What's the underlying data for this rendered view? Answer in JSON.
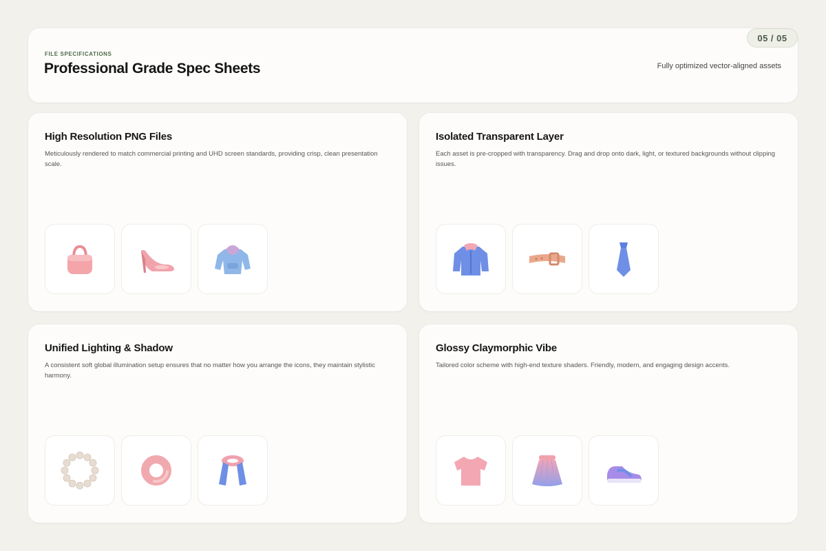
{
  "header": {
    "eyebrow": "FILE SPECIFICATIONS",
    "title": "Professional Grade Spec Sheets",
    "tagline": "Fully optimized vector-aligned assets",
    "page_indicator": "05 / 05"
  },
  "cards": [
    {
      "title": "High Resolution PNG Files",
      "description": "Meticulously rendered to match commercial printing and UHD screen standards, providing crisp, clean presentation scale.",
      "icons": [
        "handbag-icon",
        "high-heel-icon",
        "hoodie-icon"
      ]
    },
    {
      "title": "Isolated Transparent Layer",
      "description": "Each asset is pre-cropped with transparency. Drag and drop onto dark, light, or textured backgrounds without clipping issues.",
      "icons": [
        "jacket-icon",
        "belt-icon",
        "necktie-icon"
      ]
    },
    {
      "title": "Unified Lighting & Shadow",
      "description": "A consistent soft global illumination setup ensures that no matter how you arrange the icons, they maintain stylistic harmony.",
      "icons": [
        "pearl-bracelet-icon",
        "donut-ring-icon",
        "scarf-icon"
      ]
    },
    {
      "title": "Glossy Claymorphic Vibe",
      "description": "Tailored color scheme with high-end texture shaders. Friendly, modern, and engaging design accents.",
      "icons": [
        "t-shirt-icon",
        "skirt-icon",
        "sneaker-icon"
      ]
    }
  ],
  "colors": {
    "background": "#f3f1ec",
    "card": "#fdfcfa",
    "eyebrow": "#4e6a4b",
    "pink": "#f0a1a6",
    "blue": "#6f8fe6",
    "purple": "#a78be8"
  }
}
